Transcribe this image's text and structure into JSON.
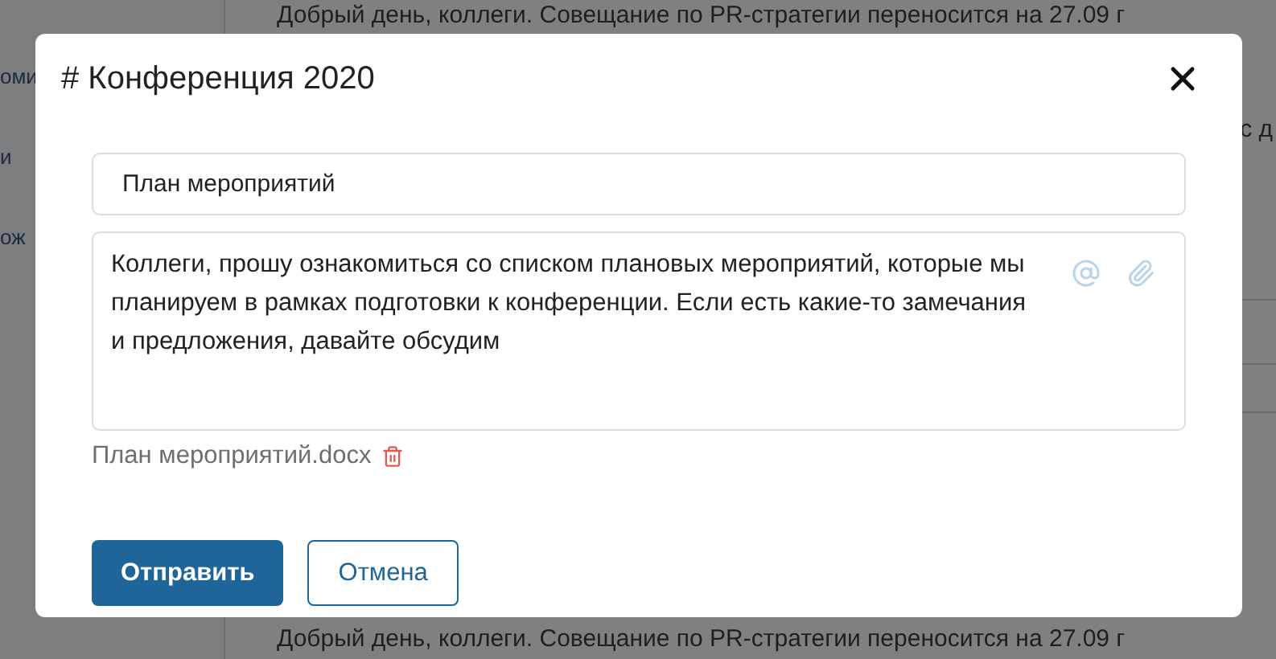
{
  "background": {
    "sidebar_items": [
      "оми",
      "и",
      "ож"
    ],
    "messages": [
      "Добрый день, коллеги. Совещание по PR-стратегии переносится на 27.09 г",
      "Добрый день, коллеги. Совещание по PR-стратегии переносится на 27.09 г"
    ],
    "side_fragment": "с д"
  },
  "dialog": {
    "title": "# Конференция 2020",
    "subject": {
      "value": "План мероприятий"
    },
    "message": {
      "value": "Коллеги, прошу ознакомиться со списком плановых мероприятий, которые мы планируем в рамках подготовки к конференции. Если есть какие-то замечания и предложения, давайте обсудим"
    },
    "attachments": [
      "План мероприятий.docx"
    ],
    "buttons": [
      {
        "label": "Отправить",
        "kind": "primary"
      },
      {
        "label": "Отмена",
        "kind": "secondary"
      }
    ]
  }
}
